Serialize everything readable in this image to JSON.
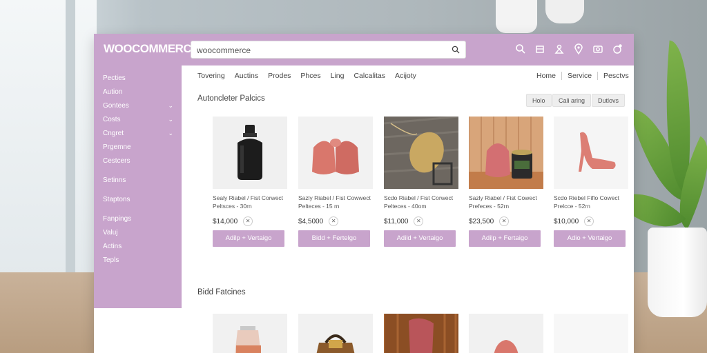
{
  "brand": {
    "logo": "WOOCOMMERCE",
    "accent": "#c8a4cc"
  },
  "search": {
    "value": "woocommerce",
    "icon": "search-icon"
  },
  "header_icons": [
    "search-icon",
    "cart-icon",
    "user-icon",
    "location-icon",
    "camera-icon",
    "notification-icon"
  ],
  "sidebar": {
    "items": [
      {
        "label": "Pecties",
        "chevron": false
      },
      {
        "label": "Aution",
        "chevron": false
      },
      {
        "label": "Gontees",
        "chevron": true
      },
      {
        "label": "Costs",
        "chevron": true
      },
      {
        "label": "Cngret",
        "chevron": true
      },
      {
        "label": "Prgemne",
        "chevron": false
      },
      {
        "label": "Cestcers",
        "chevron": false
      },
      {
        "label": "Setinns",
        "chevron": false
      },
      {
        "label": "Staptons",
        "chevron": false
      },
      {
        "label": "Fanpings",
        "chevron": false
      },
      {
        "label": "Valuj",
        "chevron": false
      },
      {
        "label": "Actins",
        "chevron": false
      },
      {
        "label": "Tepls",
        "chevron": false
      }
    ]
  },
  "nav": {
    "left": [
      "Tovering",
      "Auctins",
      "Prodes",
      "Phces",
      "Ling",
      "Calcalitas",
      "Acijoty"
    ],
    "right": [
      "Home",
      "Service",
      "Pesctvs"
    ]
  },
  "section1": {
    "title": "Autoncleter Palcics",
    "sort_buttons": [
      "Holo",
      "Cali aring",
      "Dutlovs"
    ]
  },
  "products": [
    {
      "title1": "Sealy Riabel / Fist Corwect",
      "title2": "Peltsces - 30rn",
      "price": "$14,000",
      "button": "Adilp + Vertaigo",
      "image": "black-bottle"
    },
    {
      "title1": "Sazly Riabel / Fist Cowwect",
      "title2": "Pelteces - 15 rn",
      "price": "$4,5000",
      "button": "Bidd + Fertelgo",
      "image": "pink-socks"
    },
    {
      "title1": "Scdo Riabel / Fist Corwect",
      "title2": "Pelteces - 40om",
      "price": "$11,000",
      "button": "Adild + Vertaigo",
      "image": "gold-clutch"
    },
    {
      "title1": "Sazly Riabel / Fist Cowect",
      "title2": "Prefeces - 52rn",
      "price": "$23,500",
      "button": "Adilp + Fertaigo",
      "image": "pink-bag-can"
    },
    {
      "title1": "Scdo Riebel Fiflo Cowect",
      "title2": "Prelcce - 52rn",
      "price": "$10,000",
      "button": "Adio + Vertaigo",
      "image": "pink-heel"
    }
  ],
  "section2": {
    "title": "Bidd Fatcines"
  }
}
